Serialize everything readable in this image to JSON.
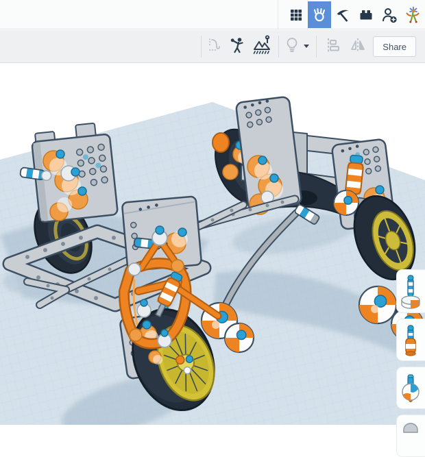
{
  "header": {
    "icons": [
      {
        "name": "grid-view-icon",
        "active": false
      },
      {
        "name": "hand-gesture-icon",
        "active": true
      },
      {
        "name": "pickaxe-icon",
        "active": false
      },
      {
        "name": "brick-icon",
        "active": false
      },
      {
        "name": "person-add-icon",
        "active": false
      },
      {
        "name": "mascot-avatar-icon",
        "active": false
      }
    ],
    "active_tile_color": "#5b8ed8"
  },
  "toolbar": {
    "share_label": "Share",
    "icons": [
      {
        "name": "drop-path-icon",
        "enabled": false
      },
      {
        "name": "person-throw-icon",
        "enabled": true
      },
      {
        "name": "terrain-flag-icon",
        "enabled": true
      },
      {
        "name": "lightbulb-icon",
        "enabled": false
      },
      {
        "name": "caret-down-icon",
        "enabled": true
      },
      {
        "name": "align-icon",
        "enabled": false
      },
      {
        "name": "mirror-icon",
        "enabled": false
      },
      {
        "name": "magnet-icon",
        "enabled": false
      }
    ],
    "disabled_color": "#b9c0c7",
    "enabled_color": "#2c3e50"
  },
  "canvas": {
    "scene_description": "isometric toy vehicle chassis built from gray perforated plates, orange suspension parts, blue striped pins, four black wheels with yellow spoked rims, on a light blue gridded workplane",
    "workplane_color": "#d5e1ea",
    "grid_color": "#b9d1e1",
    "model_palette": {
      "gray_part": "#c7cdd2",
      "orange_part": "#ee8322",
      "blue_pin": "#2ba0d4",
      "tire": "#232d39",
      "rim_yellow": "#cdbc3a",
      "outline": "#3c4f63",
      "shadow": "#a3b8ca"
    }
  },
  "parts_panel": {
    "items": [
      {
        "name": "ball-socket-connector-thumbnail"
      },
      {
        "name": "shock-absorber-thumbnail"
      },
      {
        "name": "ball-joint-thumbnail"
      },
      {
        "name": "gray-part-thumbnail-partial"
      }
    ]
  }
}
